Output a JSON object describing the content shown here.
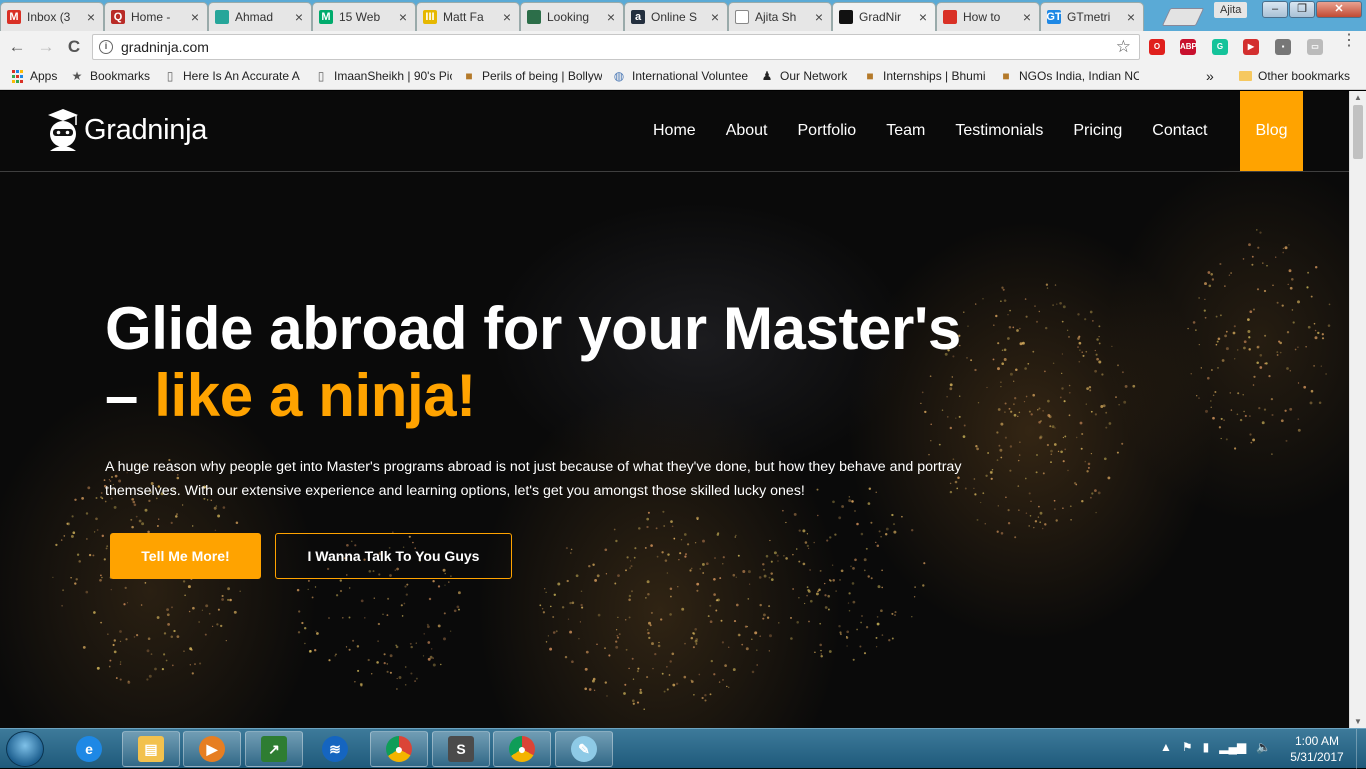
{
  "browser": {
    "tabs": [
      {
        "label": "Inbox (3",
        "favicon": "gmail-icon",
        "color": "#d93025",
        "glyph": "M"
      },
      {
        "label": "Home -",
        "favicon": "quora-icon",
        "color": "#b92b27",
        "glyph": "Q"
      },
      {
        "label": "Ahmad",
        "favicon": "site-icon",
        "color": "#26a69a",
        "glyph": ""
      },
      {
        "label": "15 Web",
        "favicon": "medium-icon",
        "color": "#00ab6c",
        "glyph": "M"
      },
      {
        "label": "Matt Fa",
        "favicon": "site-icon",
        "color": "#e6b800",
        "glyph": "III"
      },
      {
        "label": "Looking",
        "favicon": "site-icon",
        "color": "#2c6e49",
        "glyph": ""
      },
      {
        "label": "Online S",
        "favicon": "amazon-icon",
        "color": "#232f3e",
        "glyph": "a"
      },
      {
        "label": "Ajita Sh",
        "favicon": "document-icon",
        "color": "#ffffff",
        "glyph": ""
      },
      {
        "label": "GradNir",
        "favicon": "gradninja-icon",
        "color": "#111111",
        "glyph": "",
        "active": true
      },
      {
        "label": "How to",
        "favicon": "site-icon",
        "color": "#d93025",
        "glyph": ""
      },
      {
        "label": "GTmetri",
        "favicon": "gtmetrix-icon",
        "color": "#1e88e5",
        "glyph": "GT"
      }
    ],
    "profile_name": "Ajita",
    "window_buttons": {
      "minimize": "–",
      "maximize": "❐",
      "close": "✕"
    },
    "nav": {
      "back": "←",
      "forward": "→",
      "reload": "C"
    },
    "url": "gradninja.com",
    "extensions": [
      {
        "name": "opera-icon",
        "color": "#e0201d",
        "glyph": "O"
      },
      {
        "name": "adblock-icon",
        "color": "#c8102e",
        "glyph": "ABP"
      },
      {
        "name": "grammarly-icon",
        "color": "#15c39a",
        "glyph": "G"
      },
      {
        "name": "video-icon",
        "color": "#d32f2f",
        "glyph": "▶"
      },
      {
        "name": "extension-icon",
        "color": "#777777",
        "glyph": "▪"
      },
      {
        "name": "cast-icon",
        "color": "#bbbbbb",
        "glyph": "▭"
      }
    ]
  },
  "bookmarks": {
    "apps_label": "Apps",
    "items": [
      {
        "label": "Bookmarks",
        "icon": "star-icon"
      },
      {
        "label": "Here Is An Accurate A",
        "icon": "document-icon"
      },
      {
        "label": "ImaanSheikh | 90's Pic",
        "icon": "document-icon"
      },
      {
        "label": "Perils of being | Bollyw",
        "icon": "site-icon"
      },
      {
        "label": "International Voluntee",
        "icon": "globe-icon"
      },
      {
        "label": "Our Network",
        "icon": "people-icon"
      },
      {
        "label": "Internships | Bhumi",
        "icon": "site-icon"
      },
      {
        "label": "NGOs India, Indian NC",
        "icon": "site-icon"
      }
    ],
    "overflow": "»",
    "other_label": "Other bookmarks"
  },
  "site": {
    "logo_text": "Gradninja",
    "nav": [
      "Home",
      "About",
      "Portfolio",
      "Team",
      "Testimonials",
      "Pricing",
      "Contact"
    ],
    "nav_active": "Blog",
    "accent_color": "#ffa300",
    "hero": {
      "title_line1": "Glide abroad for your Master's",
      "title_dash": "– ",
      "title_accent": "like a ninja!",
      "text": "A huge reason why people get into Master's programs abroad is not just because of what they've done, but how they behave and portray themselves. With our extensive experience and learning options, let's get you amongst those skilled lucky ones!",
      "primary_button": "Tell Me More!",
      "secondary_button": "I Wanna Talk To You Guys"
    }
  },
  "taskbar": {
    "items": [
      {
        "name": "internet-explorer-icon",
        "open": false
      },
      {
        "name": "file-explorer-icon",
        "open": true
      },
      {
        "name": "media-player-icon",
        "open": true
      },
      {
        "name": "stocks-icon",
        "open": true
      },
      {
        "name": "network-icon",
        "open": false
      },
      {
        "name": "chrome-icon",
        "open": true
      },
      {
        "name": "sublime-text-icon",
        "open": true
      },
      {
        "name": "chrome-icon",
        "open": true
      },
      {
        "name": "paint-icon",
        "open": true
      }
    ],
    "time": "1:00 AM",
    "date": "5/31/2017"
  }
}
